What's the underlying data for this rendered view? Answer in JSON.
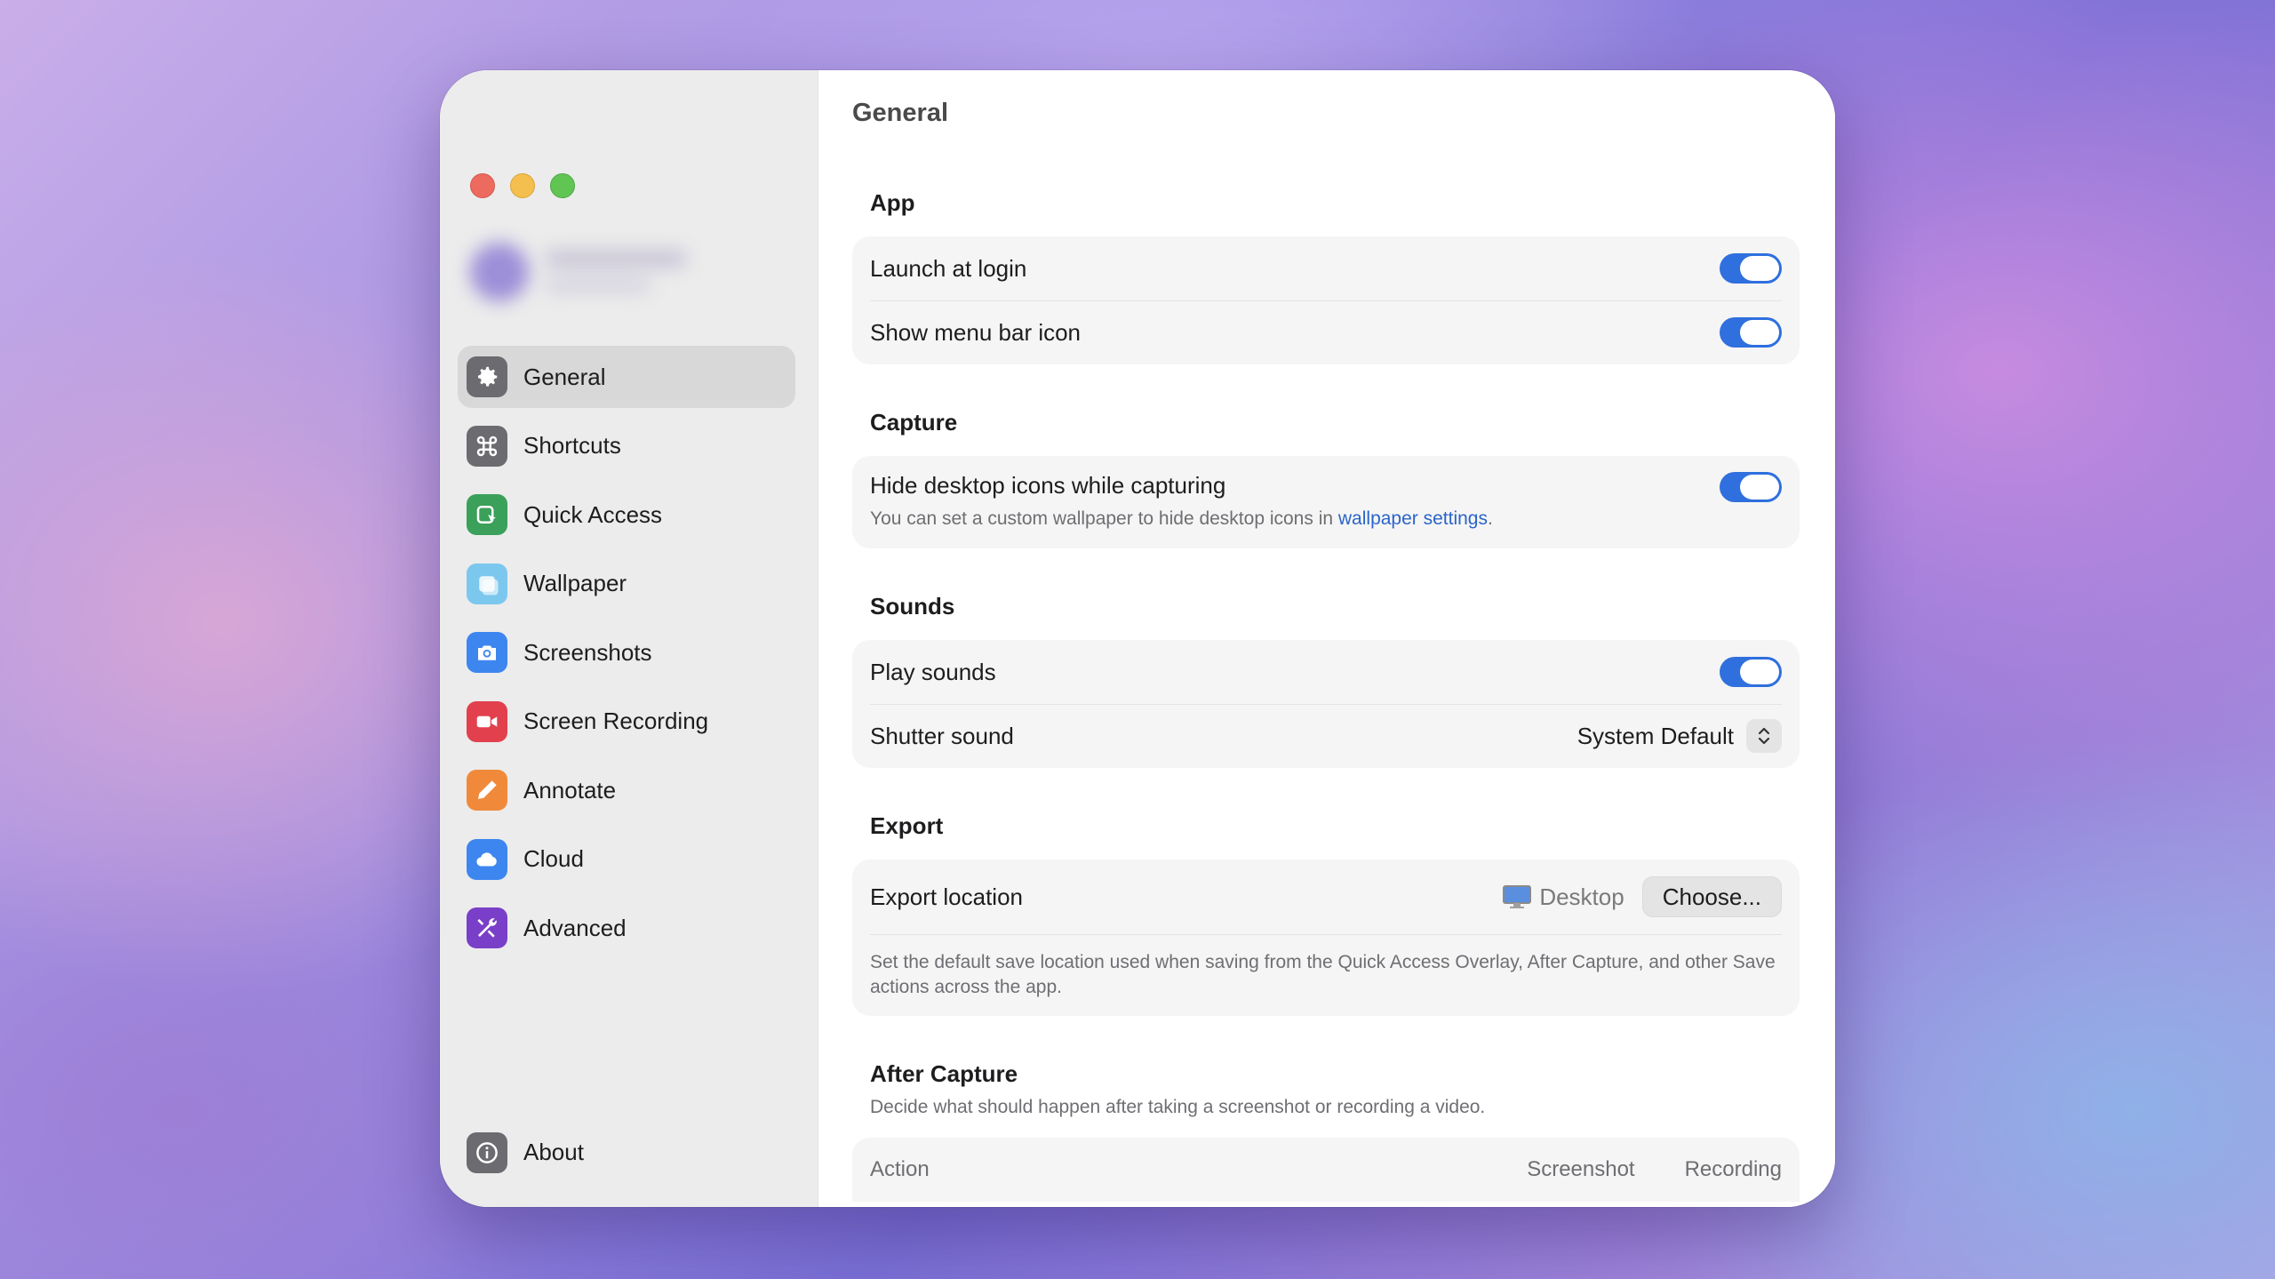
{
  "sidebar": {
    "items": [
      {
        "label": "General",
        "icon": "gear-icon",
        "color": "#6b6b70",
        "active": true
      },
      {
        "label": "Shortcuts",
        "icon": "command-icon",
        "color": "#6b6b70"
      },
      {
        "label": "Quick Access",
        "icon": "quick-access-icon",
        "color": "#3aa05a"
      },
      {
        "label": "Wallpaper",
        "icon": "wallpaper-icon",
        "color": "#7cc7ee"
      },
      {
        "label": "Screenshots",
        "icon": "camera-icon",
        "color": "#3d86f0"
      },
      {
        "label": "Screen Recording",
        "icon": "video-camera-icon",
        "color": "#e2404d"
      },
      {
        "label": "Annotate",
        "icon": "pencil-icon",
        "color": "#f08a3a"
      },
      {
        "label": "Cloud",
        "icon": "cloud-icon",
        "color": "#3d86f0"
      },
      {
        "label": "Advanced",
        "icon": "tools-icon",
        "color": "#7a3fc8"
      }
    ],
    "about": {
      "label": "About",
      "icon": "info-icon",
      "color": "#6b6b70"
    }
  },
  "main": {
    "title": "General",
    "app": {
      "title": "App",
      "launch_at_login": {
        "label": "Launch at login",
        "on": true
      },
      "show_menu_bar_icon": {
        "label": "Show menu bar icon",
        "on": true
      }
    },
    "capture": {
      "title": "Capture",
      "hide_desktop_icons": {
        "label": "Hide desktop icons while capturing",
        "on": true,
        "sub_prefix": "You can set a custom wallpaper to hide desktop icons in ",
        "sub_link": "wallpaper settings",
        "sub_suffix": "."
      }
    },
    "sounds": {
      "title": "Sounds",
      "play_sounds": {
        "label": "Play sounds",
        "on": true
      },
      "shutter_sound": {
        "label": "Shutter sound",
        "value": "System Default"
      }
    },
    "export": {
      "title": "Export",
      "location_label": "Export location",
      "location_value": "Desktop",
      "choose_button": "Choose...",
      "note": "Set the default save location used when saving from the Quick Access Overlay, After Capture, and other Save actions across the app."
    },
    "after_capture": {
      "title": "After Capture",
      "description": "Decide what should happen after taking a screenshot or recording a video.",
      "columns": [
        "Action",
        "Screenshot",
        "Recording"
      ]
    }
  },
  "colors": {
    "accent": "#2f6fde",
    "link": "#2a65c9"
  }
}
